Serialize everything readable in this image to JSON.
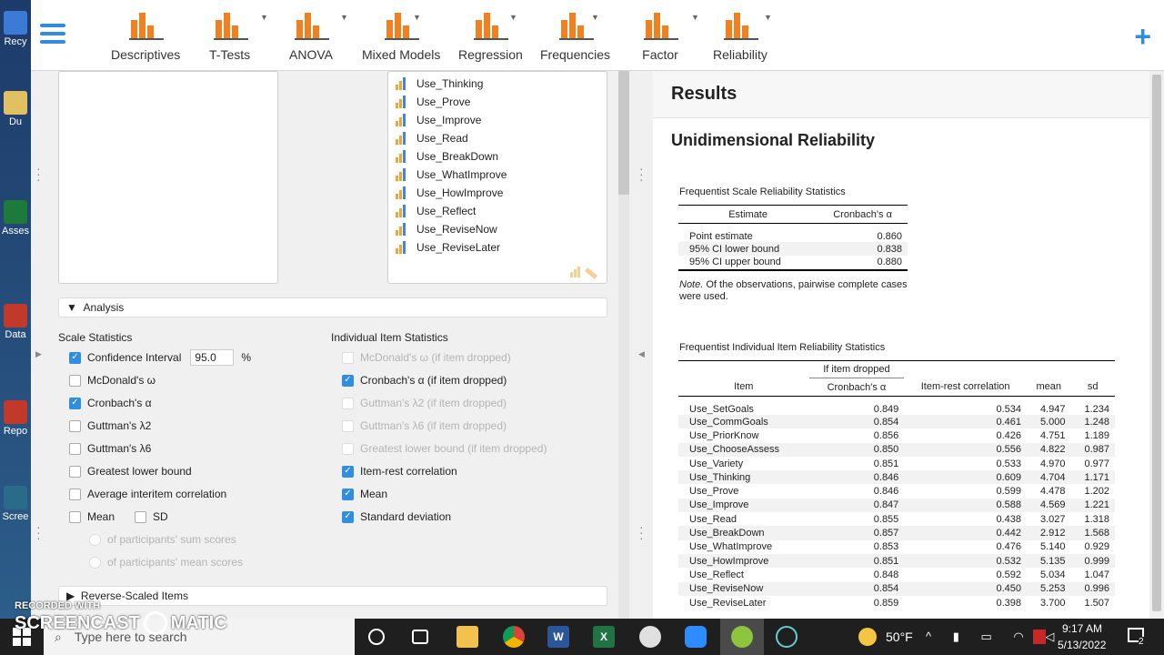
{
  "desktop": {
    "icons": [
      {
        "label": "Recy",
        "color": "#3b7bd6"
      },
      {
        "label": "Du",
        "color": "#e0c060"
      },
      {
        "label": "Asses",
        "color": "#1e7a3a"
      },
      {
        "label": "Data",
        "color": "#c0392b"
      },
      {
        "label": "Repo",
        "color": "#c0392b"
      },
      {
        "label": "Scree",
        "color": "#2a6b8a"
      }
    ]
  },
  "toolbar": {
    "tools": [
      {
        "label": "Descriptives",
        "color": "#f08020"
      },
      {
        "label": "T-Tests",
        "color": "#f08020"
      },
      {
        "label": "ANOVA",
        "color": "#f08020"
      },
      {
        "label": "Mixed Models",
        "color": "#f08020"
      },
      {
        "label": "Regression",
        "color": "#f08020"
      },
      {
        "label": "Frequencies",
        "color": "#f08020"
      },
      {
        "label": "Factor",
        "color": "#f08020"
      },
      {
        "label": "Reliability",
        "color": "#f08020"
      }
    ],
    "accent": "#2f8ee0"
  },
  "variables": [
    "Use_Thinking",
    "Use_Prove",
    "Use_Improve",
    "Use_Read",
    "Use_BreakDown",
    "Use_WhatImprove",
    "Use_HowImprove",
    "Use_Reflect",
    "Use_ReviseNow",
    "Use_ReviseLater"
  ],
  "analysis": {
    "header": "Analysis",
    "scale_title": "Scale Statistics",
    "item_title": "Individual Item Statistics",
    "ci_label": "Confidence Interval",
    "ci_value": "95.0",
    "ci_unit": "%",
    "scale_opts": [
      {
        "label": "McDonald's ω",
        "checked": false
      },
      {
        "label": "Cronbach's α",
        "checked": true
      },
      {
        "label": "Guttman's λ2",
        "checked": false
      },
      {
        "label": "Guttman's λ6",
        "checked": false
      },
      {
        "label": "Greatest lower bound",
        "checked": false
      },
      {
        "label": "Average interitem correlation",
        "checked": false
      }
    ],
    "mean_label": "Mean",
    "sd_label": "SD",
    "sum_scores": "of participants' sum scores",
    "mean_scores": "of participants' mean scores",
    "item_opts": [
      {
        "label": "McDonald's ω  (if item dropped)",
        "checked": false,
        "disabled": true
      },
      {
        "label": "Cronbach's α (if item dropped)",
        "checked": true,
        "disabled": false
      },
      {
        "label": "Guttman's λ2 (if item dropped)",
        "checked": false,
        "disabled": true
      },
      {
        "label": "Guttman's λ6 (if item dropped)",
        "checked": false,
        "disabled": true
      },
      {
        "label": "Greatest lower bound (if item dropped)",
        "checked": false,
        "disabled": true
      },
      {
        "label": "Item-rest correlation",
        "checked": true,
        "disabled": false
      },
      {
        "label": "Mean",
        "checked": true,
        "disabled": false
      },
      {
        "label": "Standard deviation",
        "checked": true,
        "disabled": false
      }
    ],
    "reverse_header": "Reverse-Scaled Items"
  },
  "results": {
    "title": "Results",
    "subtitle": "Unidimensional Reliability",
    "scale_table": {
      "caption": "Frequentist Scale Reliability Statistics",
      "headers": [
        "Estimate",
        "Cronbach's α"
      ],
      "rows": [
        [
          "Point estimate",
          "0.860"
        ],
        [
          "95% CI lower bound",
          "0.838"
        ],
        [
          "95% CI upper bound",
          "0.880"
        ]
      ],
      "note_label": "Note.",
      "note_text": " Of the observations, pairwise complete cases were used."
    },
    "item_table": {
      "caption": "Frequentist Individual Item Reliability Statistics",
      "group_header": "If item dropped",
      "headers": [
        "Item",
        "Cronbach's α",
        "Item-rest correlation",
        "mean",
        "sd"
      ],
      "rows": [
        [
          "Use_SetGoals",
          "0.849",
          "0.534",
          "4.947",
          "1.234"
        ],
        [
          "Use_CommGoals",
          "0.854",
          "0.461",
          "5.000",
          "1.248"
        ],
        [
          "Use_PriorKnow",
          "0.856",
          "0.426",
          "4.751",
          "1.189"
        ],
        [
          "Use_ChooseAssess",
          "0.850",
          "0.556",
          "4.822",
          "0.987"
        ],
        [
          "Use_Variety",
          "0.851",
          "0.533",
          "4.970",
          "0.977"
        ],
        [
          "Use_Thinking",
          "0.846",
          "0.609",
          "4.704",
          "1.171"
        ],
        [
          "Use_Prove",
          "0.846",
          "0.599",
          "4.478",
          "1.202"
        ],
        [
          "Use_Improve",
          "0.847",
          "0.588",
          "4.569",
          "1.221"
        ],
        [
          "Use_Read",
          "0.855",
          "0.438",
          "3.027",
          "1.318"
        ],
        [
          "Use_BreakDown",
          "0.857",
          "0.442",
          "2.912",
          "1.568"
        ],
        [
          "Use_WhatImprove",
          "0.853",
          "0.476",
          "5.140",
          "0.929"
        ],
        [
          "Use_HowImprove",
          "0.851",
          "0.532",
          "5.135",
          "0.999"
        ],
        [
          "Use_Reflect",
          "0.848",
          "0.592",
          "5.034",
          "1.047"
        ],
        [
          "Use_ReviseNow",
          "0.854",
          "0.450",
          "5.253",
          "0.996"
        ],
        [
          "Use_ReviseLater",
          "0.859",
          "0.398",
          "3.700",
          "1.507"
        ]
      ]
    }
  },
  "taskbar": {
    "search_placeholder": "Type here to search",
    "weather": "50°F",
    "time": "9:17 AM",
    "date": "5/13/2022",
    "notif_count": "2"
  },
  "watermark": {
    "line1": "RECORDED WITH",
    "line2": "SCREENCAST",
    "line3": "MATIC"
  }
}
